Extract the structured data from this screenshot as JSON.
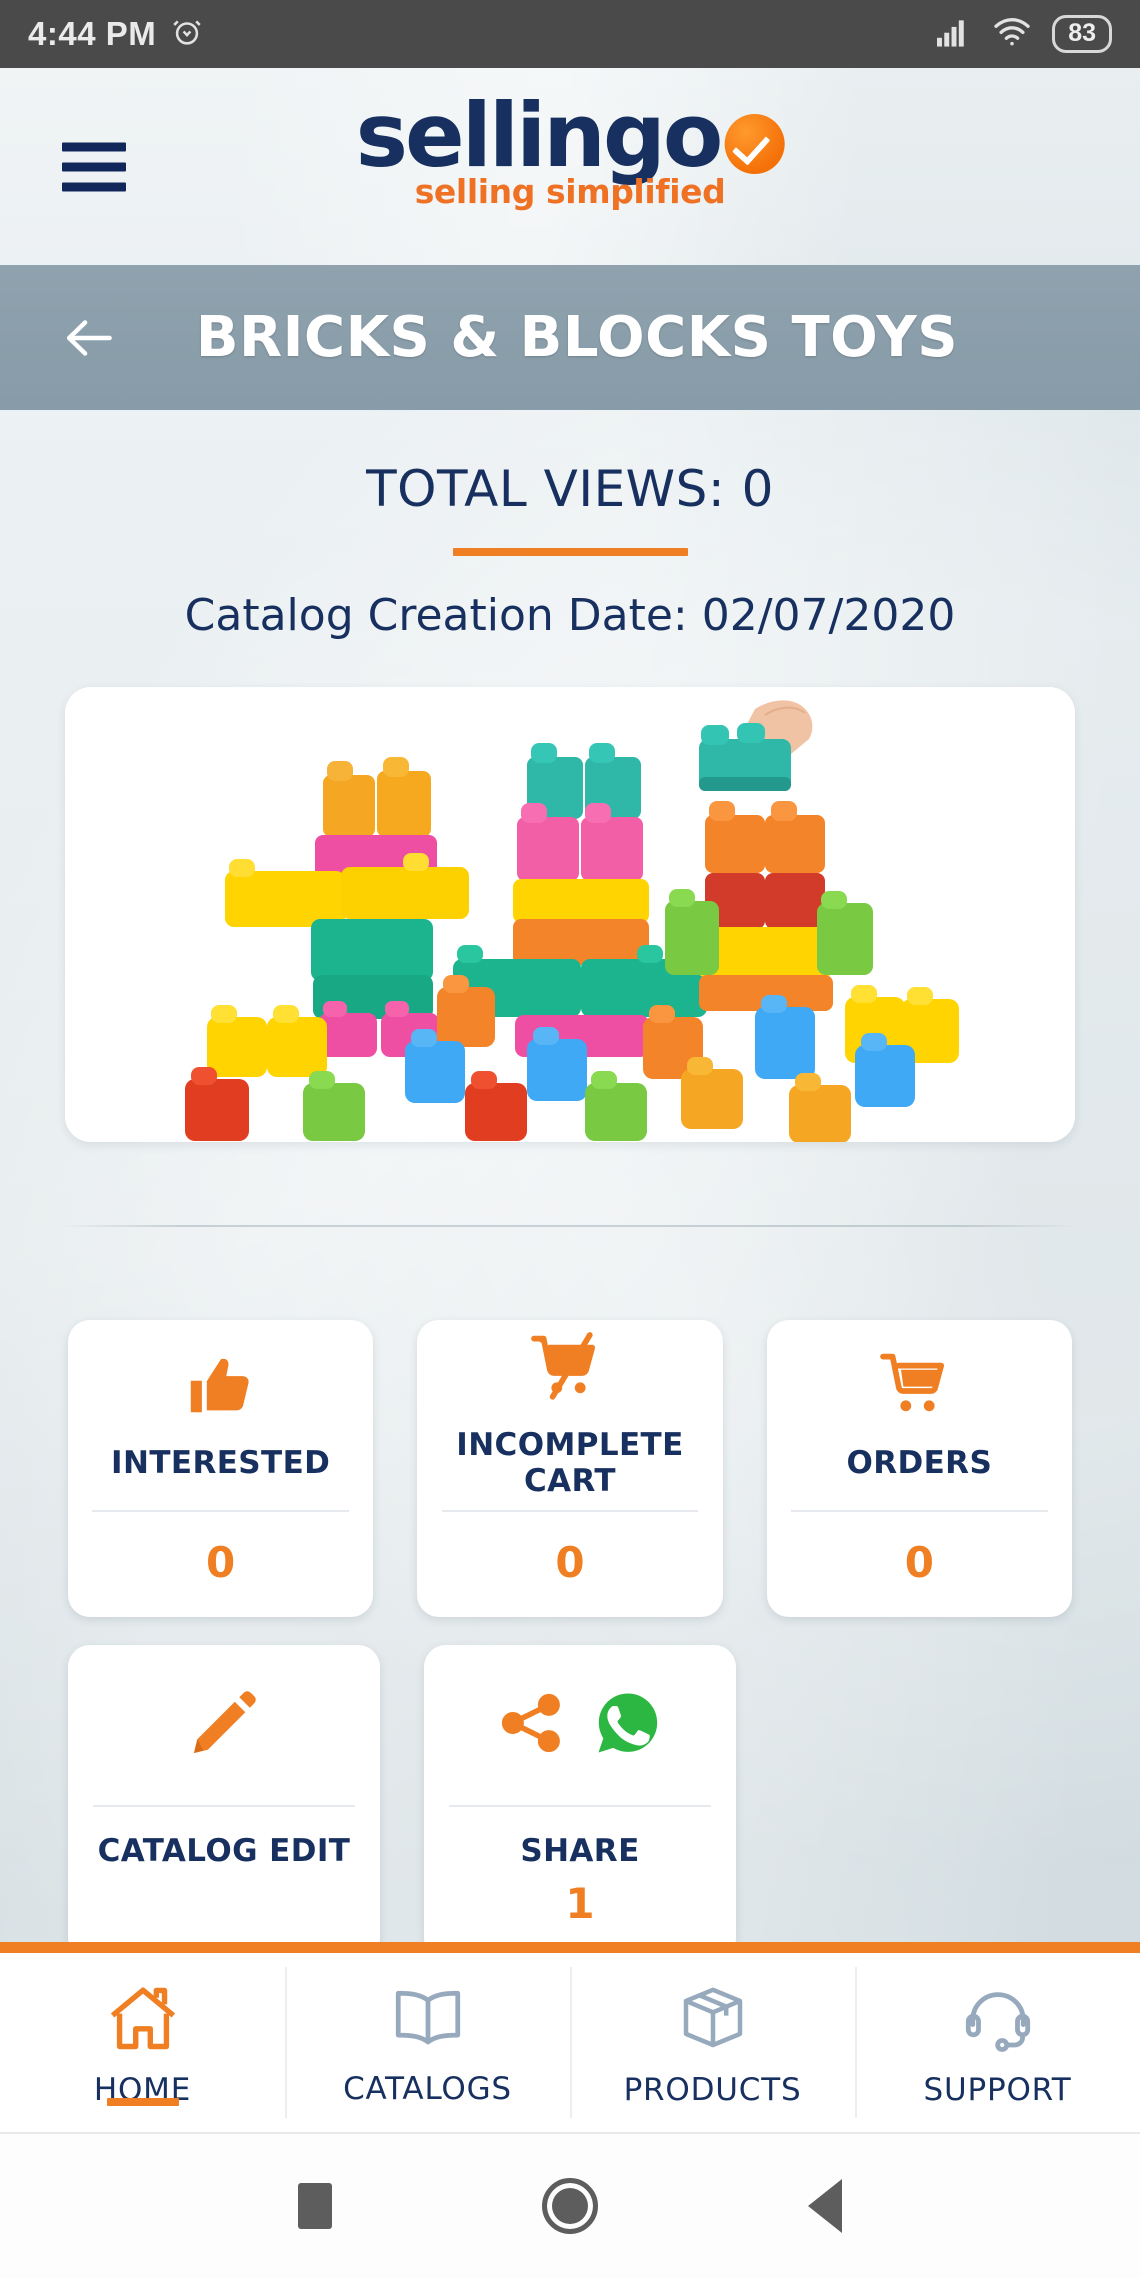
{
  "status_bar": {
    "time": "4:44 PM",
    "alarm_icon": "alarm-clock-icon",
    "signal_icon": "cellular-signal-icon",
    "wifi_icon": "wifi-icon",
    "battery_level": "83"
  },
  "header": {
    "menu_icon": "hamburger-menu-icon",
    "logo_text": "sellingo",
    "logo_tagline": "selling simplified",
    "logo_badge_icon": "orange-check-circle-icon",
    "brand_navy": "#17305f",
    "brand_orange": "#ef7f22"
  },
  "titlebar": {
    "back_icon": "back-arrow-icon",
    "title": "BRICKS & BLOCKS TOYS"
  },
  "overview": {
    "views_label": "TOTAL VIEWS: 0",
    "creation_date": "Catalog Creation Date: 02/07/2020",
    "product_image_alt": "colorful-building-blocks-photo"
  },
  "stat_cards": [
    {
      "icon": "thumbs-up-icon",
      "label": "INTERESTED",
      "count": "0",
      "layout": "count-below"
    },
    {
      "icon": "cart-slash-icon",
      "label": "INCOMPLETE CART",
      "count": "0",
      "layout": "count-below"
    },
    {
      "icon": "shopping-cart-icon",
      "label": "ORDERS",
      "count": "0",
      "layout": "count-below"
    },
    {
      "icon": "pencil-icon",
      "label": "CATALOG EDIT",
      "count": "",
      "layout": "label-below"
    },
    {
      "icon": "share-nodes-icon",
      "icon2": "whatsapp-icon",
      "label": "SHARE",
      "count": "1",
      "layout": "label-below"
    }
  ],
  "bottom_nav": [
    {
      "icon": "home-icon",
      "label": "HOME",
      "active": true
    },
    {
      "icon": "book-icon",
      "label": "CATALOGS",
      "active": false
    },
    {
      "icon": "box-icon",
      "label": "PRODUCTS",
      "active": false
    },
    {
      "icon": "headset-icon",
      "label": "SUPPORT",
      "active": false
    }
  ],
  "android_nav": {
    "recents_icon": "square-recents-icon",
    "home_icon": "circle-home-icon",
    "back_icon": "triangle-back-icon"
  }
}
